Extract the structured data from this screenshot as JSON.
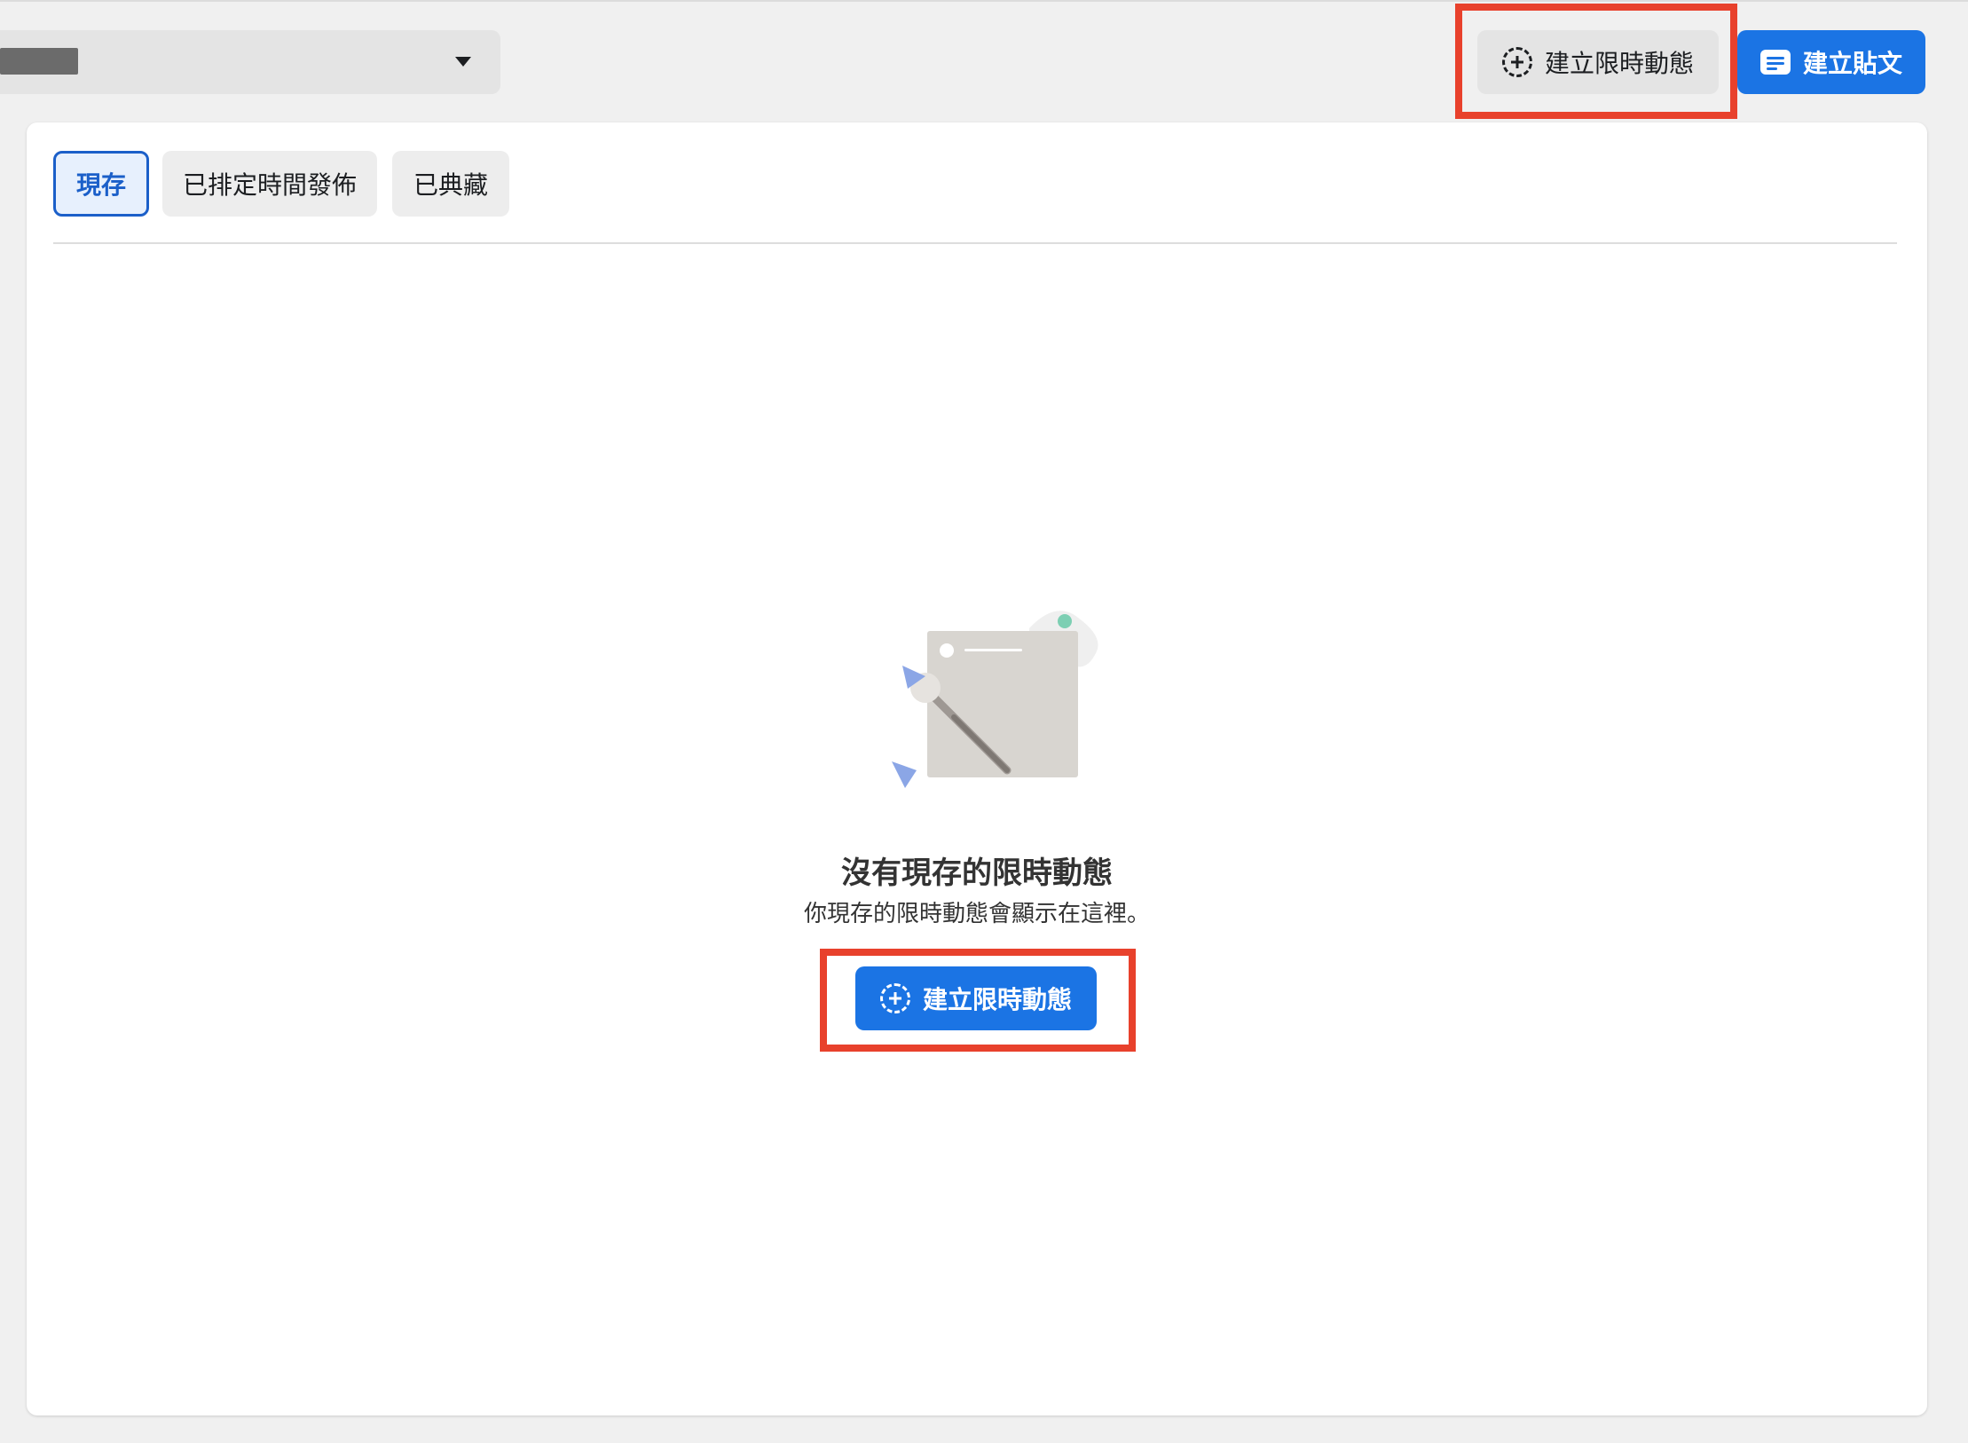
{
  "header": {
    "page_selector_value": "",
    "create_story_label": "建立限時動態",
    "create_post_label": "建立貼文"
  },
  "tabs": [
    {
      "label": "現存",
      "active": true
    },
    {
      "label": "已排定時間發佈",
      "active": false
    },
    {
      "label": "已典藏",
      "active": false
    }
  ],
  "empty_state": {
    "title": "沒有現存的限時動態",
    "subtitle": "你現存的限時動態會顯示在這裡。",
    "button_label": "建立限時動態"
  },
  "icons": {
    "create_story": "dashed-plus-circle-icon",
    "create_post": "post-icon",
    "dropdown": "caret-down-icon",
    "illustration": "canvas-paintbrush-illustration"
  },
  "colors": {
    "primary_blue": "#1b74e4",
    "active_tab_text": "#1b5fc9",
    "active_tab_bg": "#e7f0fd",
    "highlight_red": "#e8412c",
    "page_bg": "#f0f0f0"
  }
}
